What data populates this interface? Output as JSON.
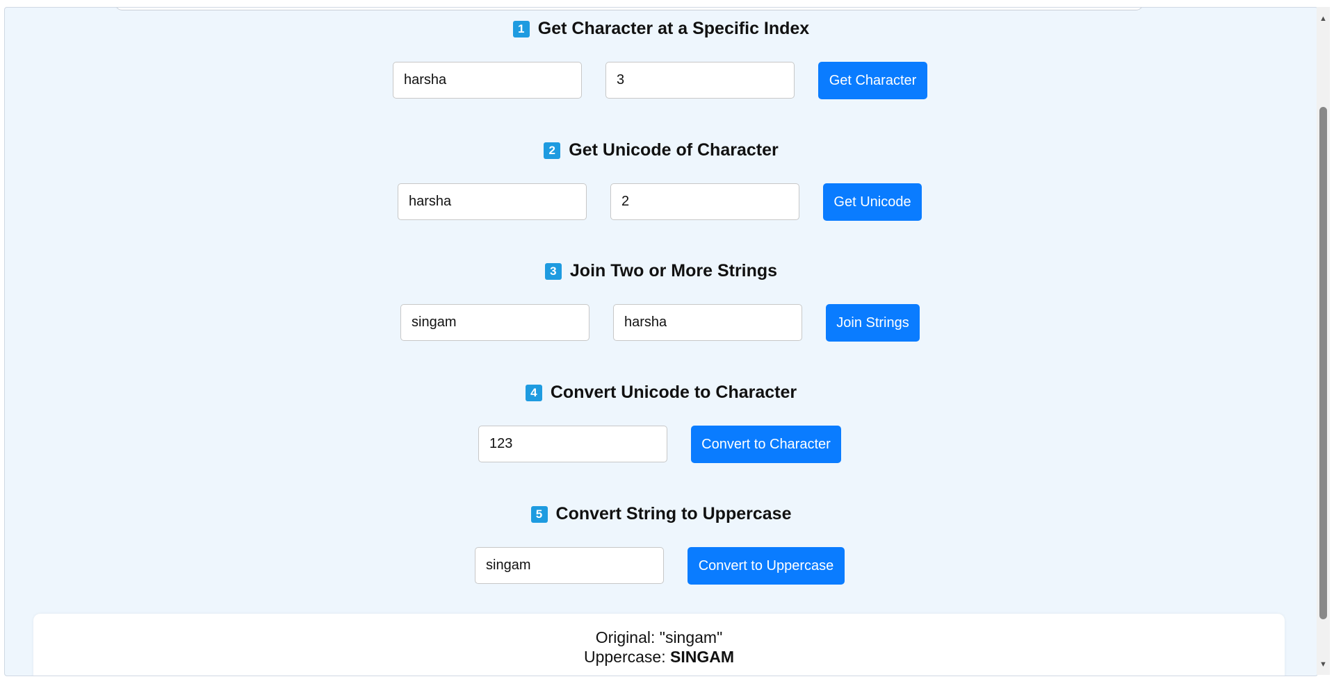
{
  "sections": [
    {
      "number": "1",
      "title": "Get Character at a Specific Index",
      "inputs": [
        "harsha",
        "3"
      ],
      "button": "Get Character"
    },
    {
      "number": "2",
      "title": "Get Unicode of Character",
      "inputs": [
        "harsha",
        "2"
      ],
      "button": "Get Unicode"
    },
    {
      "number": "3",
      "title": "Join Two or More Strings",
      "inputs": [
        "singam",
        "harsha"
      ],
      "button": "Join Strings"
    },
    {
      "number": "4",
      "title": "Convert Unicode to Character",
      "inputs": [
        "123"
      ],
      "button": "Convert to Character"
    },
    {
      "number": "5",
      "title": "Convert String to Uppercase",
      "inputs": [
        "singam"
      ],
      "button": "Convert to Uppercase"
    }
  ],
  "result": {
    "original_label": "Original: ",
    "original_value": "\"singam\"",
    "uppercase_label": "Uppercase: ",
    "uppercase_value": "SINGAM"
  },
  "colors": {
    "page_background": "#eef6fd",
    "button": "#0a7cff",
    "badge": "#1e9be0"
  },
  "icons": {
    "scroll_up": "up-arrow-icon",
    "scroll_down": "down-arrow-icon"
  }
}
